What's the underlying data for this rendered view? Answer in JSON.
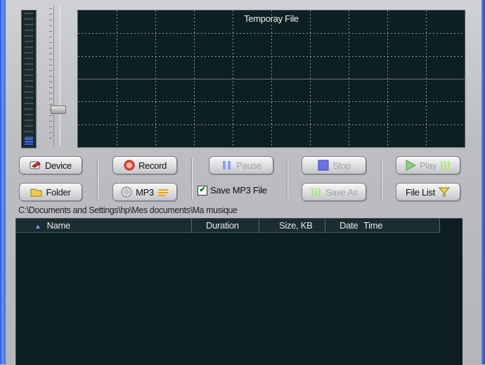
{
  "scope": {
    "title": "Temporay File"
  },
  "buttons": {
    "device": "Device",
    "folder": "Folder",
    "record": "Record",
    "mp3": "MP3",
    "pause": "Pause",
    "stop": "Stop",
    "save_as": "Save As",
    "play": "Play",
    "file_list": "File List"
  },
  "save_mp3": {
    "label": "Save MP3 File",
    "checked": true
  },
  "path": "C:\\Documents and Settings\\hp\\Mes documents\\Ma musique",
  "table": {
    "columns": [
      "Name",
      "Duration",
      "Size, KB",
      "Date",
      "Time"
    ],
    "rows": []
  },
  "colors": {
    "accent": "#3b5fd6",
    "screen": "#0d1f22",
    "grid": "#c8cdcf"
  }
}
